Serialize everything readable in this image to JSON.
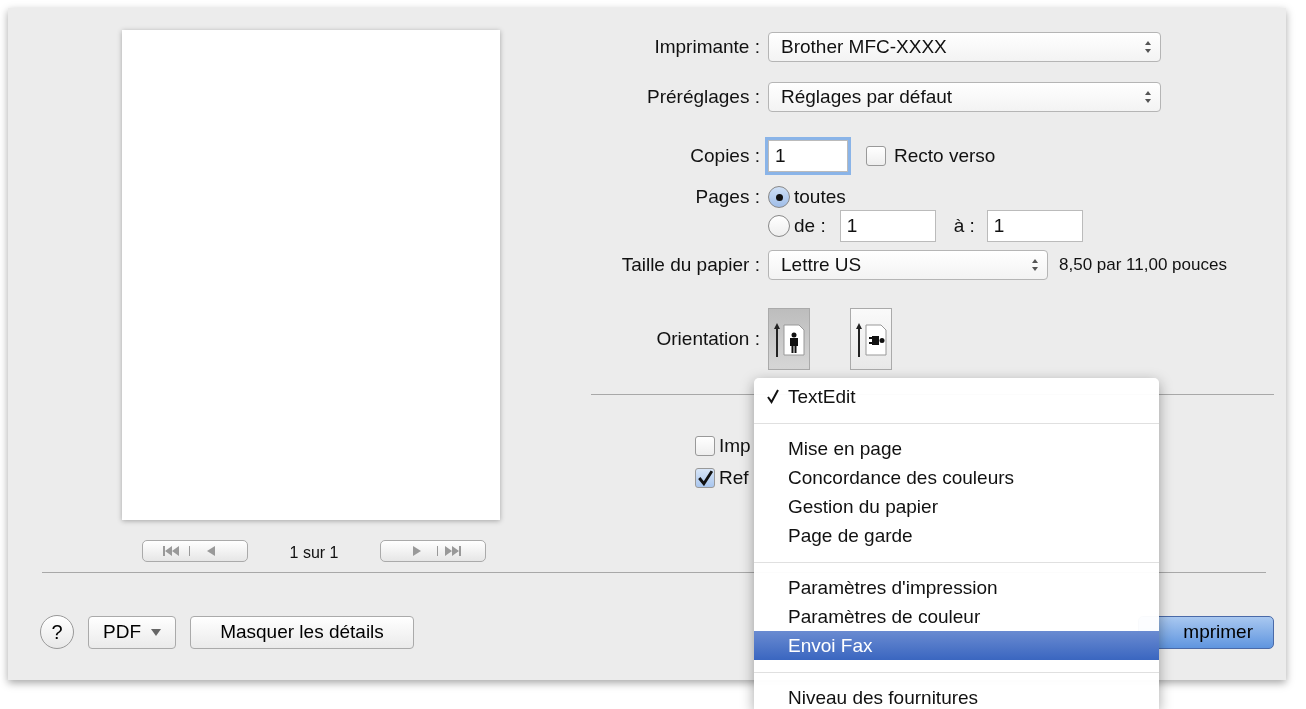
{
  "preview": {
    "page_indicator": "1 sur 1"
  },
  "form": {
    "printer": {
      "label": "Imprimante :",
      "value": "Brother MFC-XXXX"
    },
    "presets": {
      "label": "Préréglages :",
      "value": "Réglages par défaut"
    },
    "copies": {
      "label": "Copies :",
      "value": "1",
      "duplex": {
        "label": "Recto verso",
        "checked": false
      }
    },
    "pages": {
      "label": "Pages :",
      "options": [
        {
          "label": "toutes",
          "selected": true
        },
        {
          "label": "de :",
          "selected": false
        }
      ],
      "to_label": "à :",
      "from_value": "1",
      "to_value": "1"
    },
    "paper_size": {
      "label": "Taille du papier :",
      "value": "Lettre US",
      "note": "8,50 par 11,00 pouces"
    },
    "orientation": {
      "label": "Orientation :",
      "options": [
        {
          "kind": "portrait",
          "selected": true
        },
        {
          "kind": "landscape",
          "selected": false
        }
      ]
    },
    "checkboxes": [
      {
        "label": "Imp",
        "checked": false
      },
      {
        "label": "Ref",
        "checked": true
      }
    ]
  },
  "bottom_bar": {
    "help": "?",
    "pdf": "PDF",
    "details": "Masquer les détails",
    "print": "mprimer"
  },
  "menu": {
    "groups": [
      [
        {
          "label": "TextEdit",
          "checked": true,
          "selected": false
        }
      ],
      [
        {
          "label": "Mise en page",
          "checked": false,
          "selected": false
        },
        {
          "label": "Concordance des couleurs",
          "checked": false,
          "selected": false
        },
        {
          "label": "Gestion du papier",
          "checked": false,
          "selected": false
        },
        {
          "label": "Page de garde",
          "checked": false,
          "selected": false
        }
      ],
      [
        {
          "label": "Paramètres d'impression",
          "checked": false,
          "selected": false
        },
        {
          "label": "Paramètres de couleur",
          "checked": false,
          "selected": false
        },
        {
          "label": "Envoi Fax",
          "checked": false,
          "selected": true
        }
      ],
      [
        {
          "label": "Niveau des fournitures",
          "checked": false,
          "selected": false
        }
      ]
    ]
  }
}
